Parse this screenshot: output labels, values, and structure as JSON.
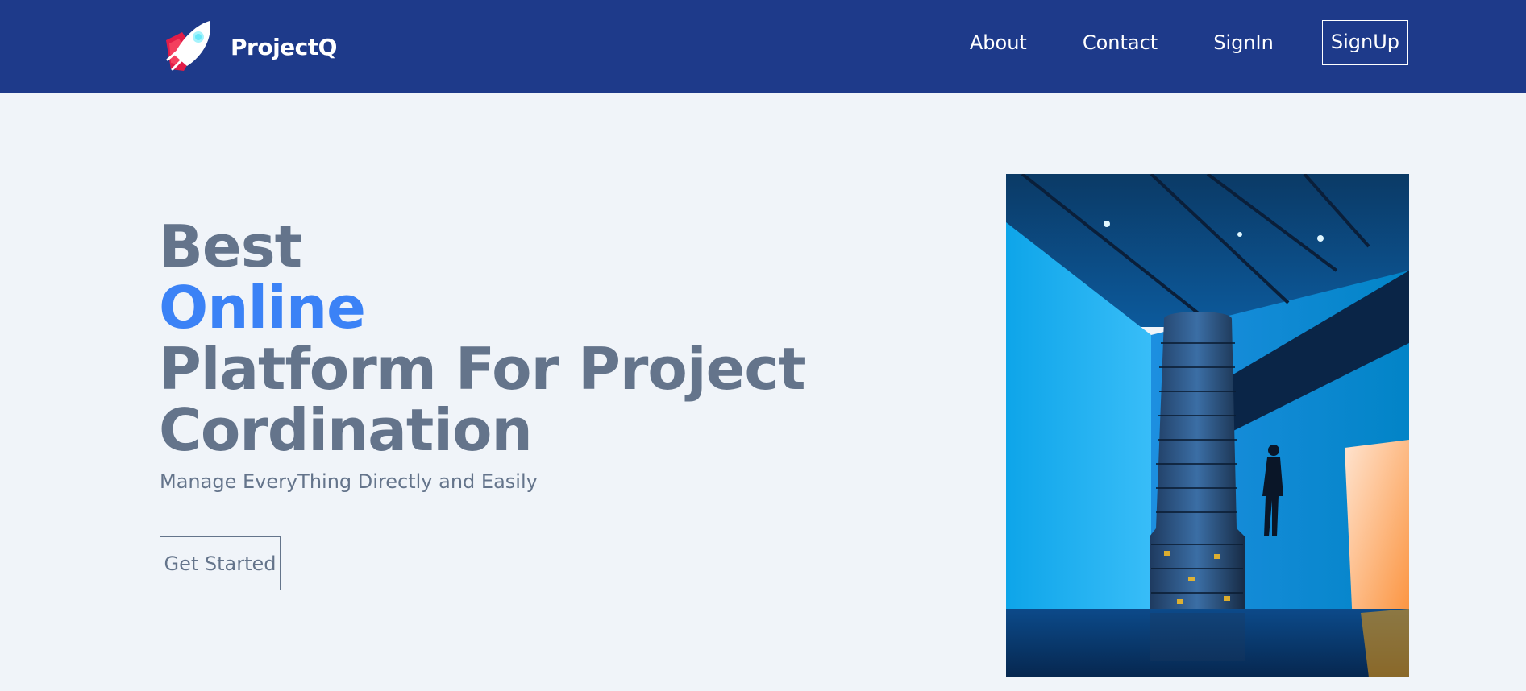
{
  "header": {
    "brand_name": "ProjectQ",
    "logo_icon": "rocket-icon",
    "nav": [
      {
        "label": "About"
      },
      {
        "label": "Contact"
      },
      {
        "label": "SignIn"
      }
    ],
    "signup_label": "SignUp"
  },
  "hero": {
    "title_lines": [
      "Best",
      "Online",
      "Platform For Project",
      "Cordination"
    ],
    "subtitle": "Manage EveryThing Directly and Easily",
    "cta_label": "Get Started",
    "image_subject": "museum-tower-photo"
  },
  "colors": {
    "header_bg": "#1e3a8a",
    "page_bg": "#f0f4f9",
    "text_muted": "#64748b",
    "accent": "#3b82f6"
  }
}
